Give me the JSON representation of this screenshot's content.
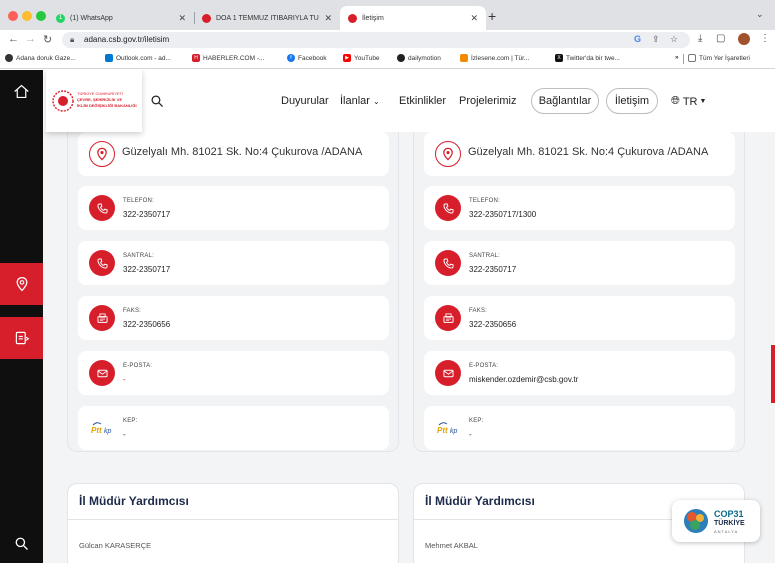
{
  "browser": {
    "tabs": [
      {
        "title": "(1) WhatsApp",
        "badge": "1"
      },
      {
        "title": "DOA 1 TEMMUZ İTİBARIYLA TÜ"
      },
      {
        "title": "İletişim"
      }
    ],
    "url": "adana.csb.gov.tr/iletisim",
    "bookmarks": [
      "Adana doruk Gaze...",
      "Outlook.com - ad...",
      "HABERLER.COM -...",
      "Facebook",
      "YouTube",
      "dailymotion",
      "İzlesene.com | Tür...",
      "Twitter'da bir twe...",
      "»",
      "Tüm Yer İşaretleri"
    ]
  },
  "site": {
    "nav": [
      "Duyurular",
      "İlanlar",
      "Etkinlikler",
      "Projelerimiz"
    ],
    "pills": [
      "Bağlantılar",
      "İletişim"
    ],
    "lang": "TR",
    "logo_lines": [
      "TÜRKİYE CUMHURİYETİ",
      "ÇEVRE, ŞEHİRCİLİK VE",
      "İKLİM DEĞİŞİKLİĞİ BAKANLIĞI"
    ]
  },
  "contact": {
    "labels": {
      "phone": "TELEFON:",
      "switchboard": "SANTRAL:",
      "fax": "FAKS:",
      "email": "E-POSTA:",
      "kep": "KEP:"
    },
    "left": {
      "address": "Güzelyalı Mh. 81021 Sk. No:4 Çukurova /ADANA",
      "phone": "322-2350717",
      "switchboard": "322-2350717",
      "fax": "322-2350656",
      "email": "-",
      "kep": "-"
    },
    "right": {
      "address": "Güzelyalı Mh. 81021 Sk. No:4 Çukurova /ADANA",
      "phone": "322-2350717/1300",
      "switchboard": "322-2350717",
      "fax": "322-2350656",
      "email": "miskender.ozdemir@csb.gov.tr",
      "kep": "-"
    }
  },
  "deputies": [
    {
      "title": "İl Müdür Yardımcısı",
      "name": "Gülcan KARASERÇE"
    },
    {
      "title": "İl Müdür Yardımcısı",
      "name": "Mehmet AKBAL"
    }
  ],
  "cop": {
    "line1": "COP31",
    "line2": "TÜRKİYE",
    "line3": "ANTALYA"
  },
  "colors": {
    "accent": "#d71f2c",
    "rail": "#0f0f0f",
    "title": "#1d2a4a"
  }
}
